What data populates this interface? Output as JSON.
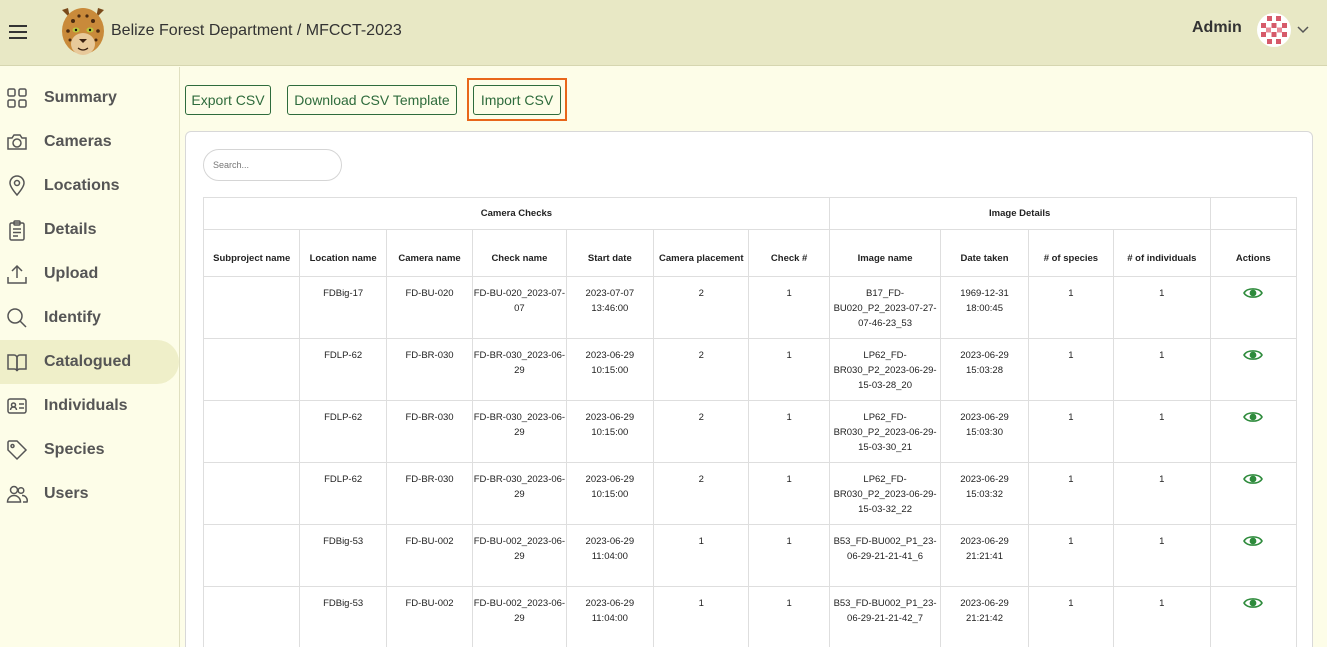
{
  "header": {
    "title": "Belize Forest Department / MFCCT-2023",
    "user_name": "Admin"
  },
  "sidebar": {
    "items": [
      {
        "label": "Summary",
        "icon": "grid-icon"
      },
      {
        "label": "Cameras",
        "icon": "camera-icon"
      },
      {
        "label": "Locations",
        "icon": "location-pin-icon"
      },
      {
        "label": "Details",
        "icon": "clipboard-icon"
      },
      {
        "label": "Upload",
        "icon": "upload-icon"
      },
      {
        "label": "Identify",
        "icon": "search-icon"
      },
      {
        "label": "Catalogued",
        "icon": "book-icon",
        "active": true
      },
      {
        "label": "Individuals",
        "icon": "id-card-icon"
      },
      {
        "label": "Species",
        "icon": "tag-icon"
      },
      {
        "label": "Users",
        "icon": "users-icon"
      }
    ]
  },
  "toolbar": {
    "export_label": "Export CSV",
    "template_label": "Download CSV Template",
    "import_label": "Import CSV"
  },
  "search": {
    "placeholder": "Search..."
  },
  "table": {
    "groups": {
      "camera_checks": "Camera Checks",
      "image_details": "Image Details"
    },
    "columns": [
      "Subproject name",
      "Location name",
      "Camera name",
      "Check name",
      "Start date",
      "Camera placement",
      "Check #",
      "Image name",
      "Date taken",
      "# of species",
      "# of individuals",
      "Actions"
    ],
    "rows": [
      {
        "subproject": "",
        "location": "FDBig-17",
        "camera": "FD-BU-020",
        "check": "FD-BU-020_2023-07-07",
        "start": "2023-07-07 13:46:00",
        "placement": "2",
        "check_no": "1",
        "image": "B17_FD-BU020_P2_2023-07-27-07-46-23_53",
        "taken": "1969-12-31 18:00:45",
        "species": "1",
        "individuals": "1"
      },
      {
        "subproject": "",
        "location": "FDLP-62",
        "camera": "FD-BR-030",
        "check": "FD-BR-030_2023-06-29",
        "start": "2023-06-29 10:15:00",
        "placement": "2",
        "check_no": "1",
        "image": "LP62_FD-BR030_P2_2023-06-29-15-03-28_20",
        "taken": "2023-06-29 15:03:28",
        "species": "1",
        "individuals": "1"
      },
      {
        "subproject": "",
        "location": "FDLP-62",
        "camera": "FD-BR-030",
        "check": "FD-BR-030_2023-06-29",
        "start": "2023-06-29 10:15:00",
        "placement": "2",
        "check_no": "1",
        "image": "LP62_FD-BR030_P2_2023-06-29-15-03-30_21",
        "taken": "2023-06-29 15:03:30",
        "species": "1",
        "individuals": "1"
      },
      {
        "subproject": "",
        "location": "FDLP-62",
        "camera": "FD-BR-030",
        "check": "FD-BR-030_2023-06-29",
        "start": "2023-06-29 10:15:00",
        "placement": "2",
        "check_no": "1",
        "image": "LP62_FD-BR030_P2_2023-06-29-15-03-32_22",
        "taken": "2023-06-29 15:03:32",
        "species": "1",
        "individuals": "1"
      },
      {
        "subproject": "",
        "location": "FDBig-53",
        "camera": "FD-BU-002",
        "check": "FD-BU-002_2023-06-29",
        "start": "2023-06-29 11:04:00",
        "placement": "1",
        "check_no": "1",
        "image": "B53_FD-BU002_P1_23-06-29-21-21-41_6",
        "taken": "2023-06-29 21:21:41",
        "species": "1",
        "individuals": "1"
      },
      {
        "subproject": "",
        "location": "FDBig-53",
        "camera": "FD-BU-002",
        "check": "FD-BU-002_2023-06-29",
        "start": "2023-06-29 11:04:00",
        "placement": "1",
        "check_no": "1",
        "image": "B53_FD-BU002_P1_23-06-29-21-21-42_7",
        "taken": "2023-06-29 21:21:42",
        "species": "1",
        "individuals": "1"
      }
    ]
  },
  "colors": {
    "header_bg": "#e8e8c5",
    "page_bg": "#fdfde8",
    "accent_green": "#2e6b3c",
    "action_eye": "#2e8b3c",
    "highlight_orange": "#e8661a",
    "active_nav_bg": "#efefc9"
  }
}
